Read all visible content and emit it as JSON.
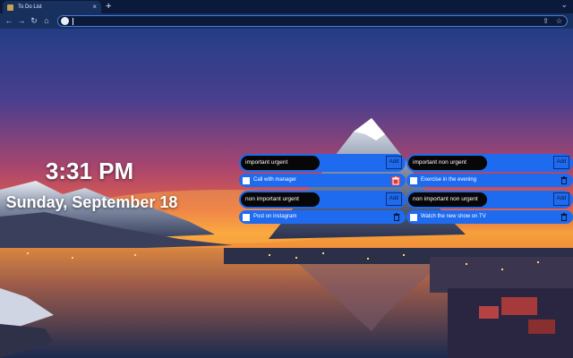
{
  "browser": {
    "tab_title": "To Do List",
    "tab_close_icon": "close-icon",
    "new_tab_label": "+",
    "address_value": ""
  },
  "clock": {
    "time": "3:31 PM",
    "date": "Sunday, September 18"
  },
  "quadrants": [
    {
      "input_value": "important urgent",
      "add_label": "Add",
      "items": [
        {
          "text": "Call with manager",
          "checked": false
        }
      ]
    },
    {
      "input_value": "important non urgent",
      "add_label": "Add",
      "items": [
        {
          "text": "Exercise in the evening",
          "checked": false
        }
      ]
    },
    {
      "input_value": "non important urgent",
      "add_label": "Add",
      "items": [
        {
          "text": "Post on instagram",
          "checked": false
        }
      ]
    },
    {
      "input_value": "non important non urgent",
      "add_label": "Add",
      "items": [
        {
          "text": "Watch the new show on TV",
          "checked": false
        }
      ]
    }
  ],
  "colors": {
    "accent": "#1f6bf0",
    "delete_hover": "#e33b3b",
    "input_bg": "#070707"
  }
}
